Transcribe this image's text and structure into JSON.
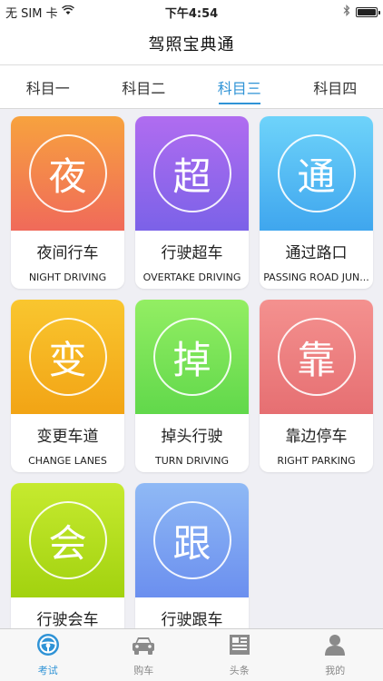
{
  "status": {
    "carrier": "无 SIM 卡",
    "time": "下午4:54"
  },
  "app": {
    "title": "驾照宝典通"
  },
  "tabs": [
    {
      "label": "科目一"
    },
    {
      "label": "科目二"
    },
    {
      "label": "科目三"
    },
    {
      "label": "科目四"
    }
  ],
  "active_tab": "科目三",
  "cards": [
    {
      "glyph": "夜",
      "title": "夜间行车",
      "subtitle": "NIGHT DRIVING",
      "gradient": [
        "#f7a23e",
        "#f06a5a"
      ]
    },
    {
      "glyph": "超",
      "title": "行驶超车",
      "subtitle": "OVERTAKE DRIVING",
      "gradient": [
        "#b06cf0",
        "#7b62e8"
      ]
    },
    {
      "glyph": "通",
      "title": "通过路口",
      "subtitle": "PASSING ROAD JUN...",
      "gradient": [
        "#6ed3fa",
        "#3fa6ee"
      ]
    },
    {
      "glyph": "变",
      "title": "变更车道",
      "subtitle": "CHANGE LANES",
      "gradient": [
        "#f9c62f",
        "#f2a415"
      ]
    },
    {
      "glyph": "掉",
      "title": "掉头行驶",
      "subtitle": "TURN DRIVING",
      "gradient": [
        "#93ee63",
        "#61d84b"
      ]
    },
    {
      "glyph": "靠",
      "title": "靠边停车",
      "subtitle": "RIGHT PARKING",
      "gradient": [
        "#f4918f",
        "#e66f72"
      ]
    },
    {
      "glyph": "会",
      "title": "行驶会车",
      "subtitle": "",
      "gradient": [
        "#c6ea2f",
        "#a2d20f"
      ]
    },
    {
      "glyph": "跟",
      "title": "行驶跟车",
      "subtitle": "",
      "gradient": [
        "#8fb9f5",
        "#6b8fef"
      ]
    }
  ],
  "tabbar": [
    {
      "label": "考试",
      "icon": "steering-wheel-icon"
    },
    {
      "label": "购车",
      "icon": "car-icon"
    },
    {
      "label": "头条",
      "icon": "newspaper-icon"
    },
    {
      "label": "我的",
      "icon": "person-icon"
    }
  ],
  "colors": {
    "accent": "#2f93d6",
    "tab_inactive": "#888888"
  }
}
